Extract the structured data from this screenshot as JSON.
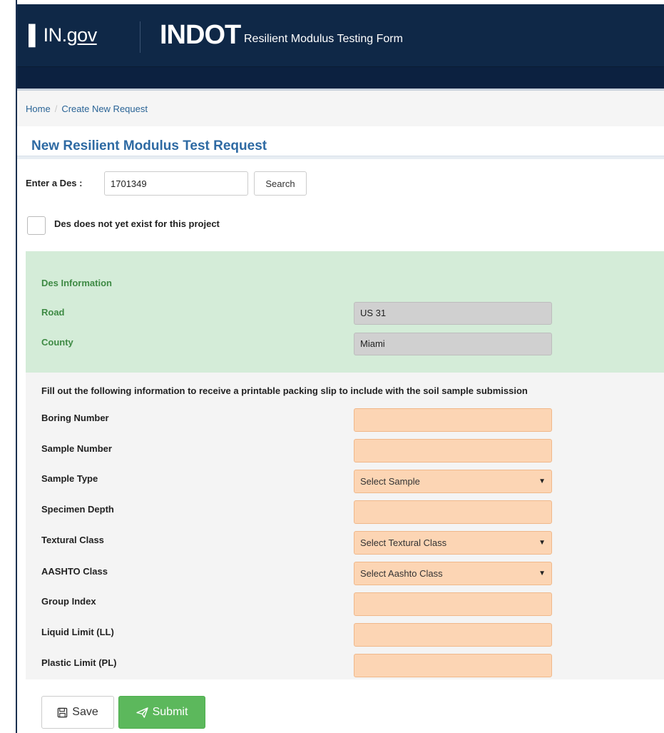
{
  "header": {
    "gov_logo_mark": "▌",
    "gov_logo_text": "IN.",
    "gov_logo_suffix": "gov",
    "agency_logo": "INDOT",
    "app_title": "Resilient Modulus Testing Form"
  },
  "breadcrumb": {
    "home": "Home",
    "separator": "/",
    "current": "Create New Request"
  },
  "page_title": "New Resilient Modulus Test Request",
  "des_search": {
    "label": "Enter a Des :",
    "value": "1701349",
    "button": "Search"
  },
  "des_not_exist": {
    "checked": false,
    "label": "Des does not yet exist for this project"
  },
  "des_info": {
    "heading": "Des Information",
    "road_label": "Road",
    "road_value": "US 31",
    "county_label": "County",
    "county_value": "Miami"
  },
  "form": {
    "instructions": "Fill out the following information to receive a printable packing slip to include with the soil sample submission",
    "boring_number": {
      "label": "Boring Number",
      "value": ""
    },
    "sample_number": {
      "label": "Sample Number",
      "value": ""
    },
    "sample_type": {
      "label": "Sample Type",
      "selected": "Select Sample"
    },
    "specimen_depth": {
      "label": "Specimen Depth",
      "value": ""
    },
    "textural_class": {
      "label": "Textural Class",
      "selected": "Select Textural Class"
    },
    "aashto_class": {
      "label": "AASHTO Class",
      "selected": "Select Aashto Class"
    },
    "group_index": {
      "label": "Group Index",
      "value": ""
    },
    "liquid_limit": {
      "label": "Liquid Limit (LL)",
      "value": ""
    },
    "plastic_limit": {
      "label": "Plastic Limit (PL)",
      "value": ""
    }
  },
  "actions": {
    "save_icon": "floppy-disk-icon",
    "save_label": "Save",
    "submit_icon": "paper-plane-icon",
    "submit_label": "Submit"
  },
  "colors": {
    "header_bg": "#0f2847",
    "title_blue": "#2e6aa3",
    "info_panel_bg": "#d4ecd8",
    "info_label_green": "#3e8a44",
    "required_field_bg": "#fcd5b4",
    "submit_green": "#5cb85c"
  }
}
